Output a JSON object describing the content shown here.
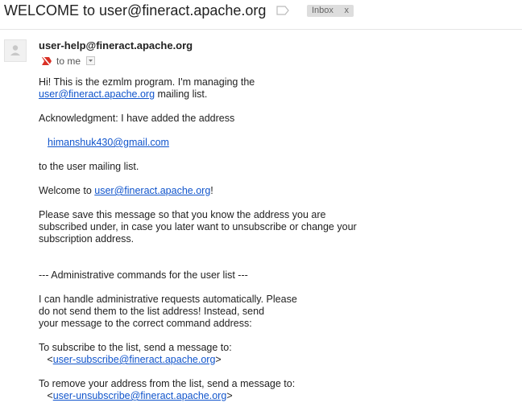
{
  "subject": "WELCOME to user@fineract.apache.org",
  "label": {
    "name": "Inbox",
    "remove": "x"
  },
  "sender": "user-help@fineract.apache.org",
  "recipient_text": "to me",
  "icons": {
    "avatar": "person-icon",
    "label": "label-tag-icon",
    "important": "important-marker-icon",
    "dropdown": "chevron-down-icon"
  },
  "colors": {
    "link": "#1155cc",
    "important": "#d93025",
    "chip": "#dddddd"
  },
  "body": {
    "l1": "Hi! This is the ezmlm program. I'm managing the",
    "l2_link": "user@fineract.apache.org",
    "l2_rest": " mailing list.",
    "l3": "Acknowledgment: I have added the address",
    "l4_link": "himanshuk430@gmail.com",
    "l5": "to the user mailing list.",
    "l6_pre": "Welcome to ",
    "l6_link": "user@fineract.apache.org",
    "l6_post": "!",
    "l7": "Please save this message so that you know the address you are",
    "l8": "subscribed under, in case you later want to unsubscribe or change your",
    "l9": "subscription address.",
    "l10": "--- Administrative commands for the user list ---",
    "l11": "I can handle administrative requests automatically. Please",
    "l12": "do not send them to the list address! Instead, send",
    "l13": "your message to the correct command address:",
    "l14": "To subscribe to the list, send a message to:",
    "l15_pre": "   <",
    "l15_link": "user-subscribe@fineract.apache.org",
    "l15_post": ">",
    "l16": "To remove your address from the list, send a message to:",
    "l17_pre": "   <",
    "l17_link": "user-unsubscribe@fineract.apache.org",
    "l17_post": ">"
  }
}
